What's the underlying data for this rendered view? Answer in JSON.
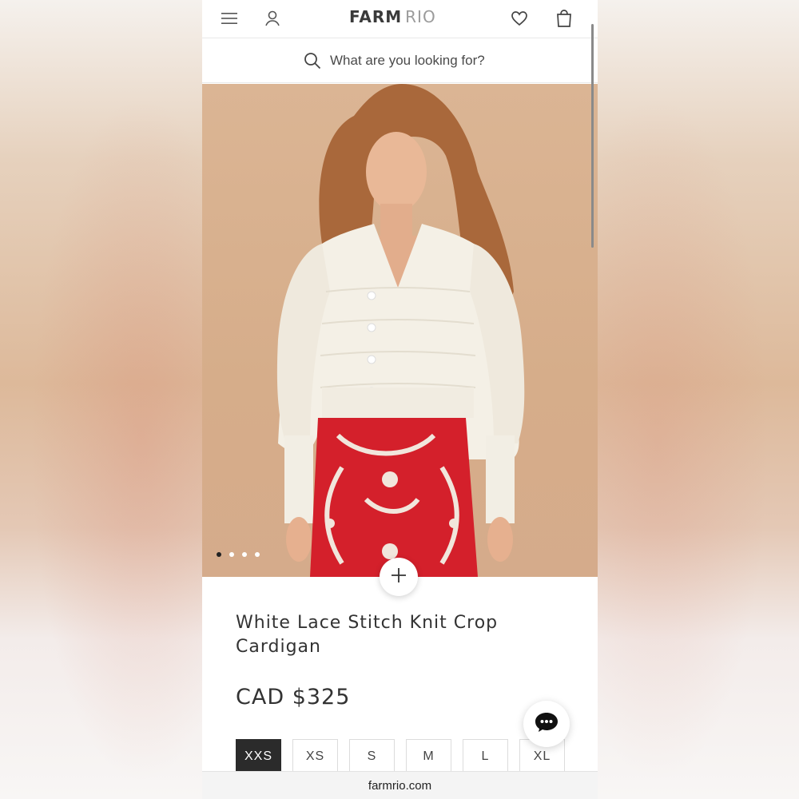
{
  "header": {
    "menu_icon": "hamburger-menu-icon",
    "account_icon": "user-icon",
    "logo_primary": "FARM",
    "logo_secondary": "RIO",
    "wishlist_icon": "heart-icon",
    "bag_icon": "shopping-bag-icon"
  },
  "search": {
    "icon": "search-icon",
    "placeholder": "What are you looking for?"
  },
  "gallery": {
    "dots_total": 4,
    "active_index": 0,
    "zoom_icon": "plus-icon"
  },
  "product": {
    "title": "White Lace Stitch Knit Crop Cardigan",
    "price": "CAD $325"
  },
  "sizes": {
    "options": [
      "XXS",
      "XS",
      "S",
      "M",
      "L",
      "XL"
    ],
    "selected": "XXS"
  },
  "chat": {
    "icon": "chat-bubble-icon"
  },
  "browser": {
    "url": "farmrio.com"
  },
  "colors": {
    "background_beige": "#dbb594",
    "selected_size": "#2b2b2b",
    "skirt_red": "#d4202b"
  }
}
